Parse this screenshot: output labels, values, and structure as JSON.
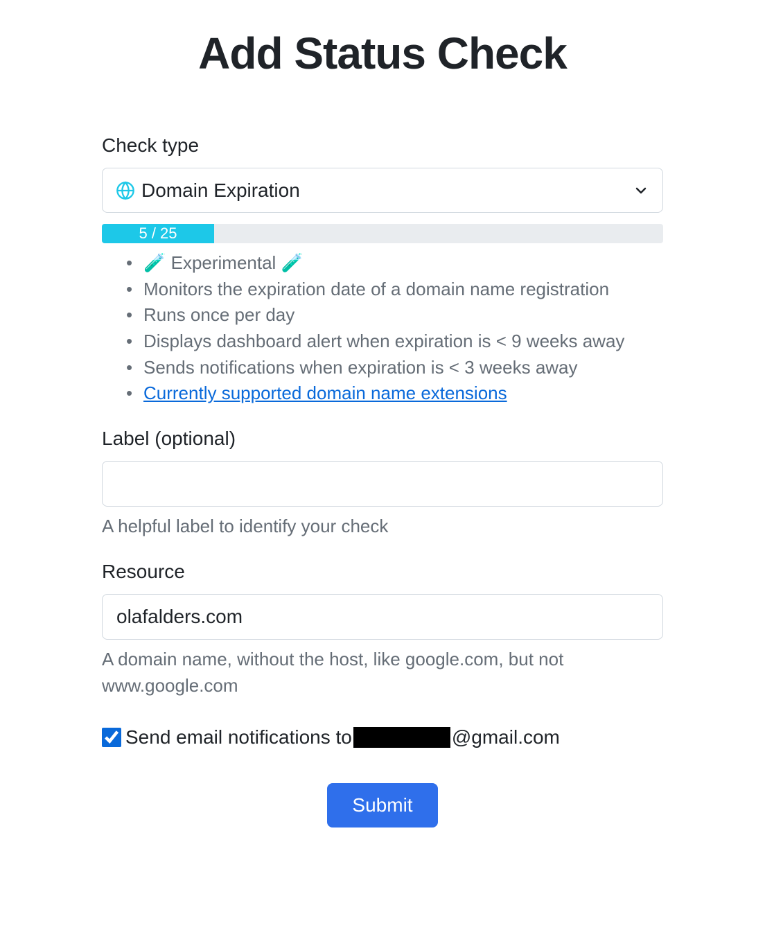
{
  "page": {
    "title": "Add Status Check"
  },
  "check_type": {
    "label": "Check type",
    "selected": "Domain Expiration",
    "icon_name": "globe-icon",
    "usage": {
      "current": 5,
      "max": 25,
      "display": "5 / 25",
      "percent": 20
    },
    "description_items": [
      "🧪 Experimental 🧪",
      "Monitors the expiration date of a domain name registration",
      "Runs once per day",
      "Displays dashboard alert when expiration is < 9 weeks away",
      "Sends notifications when expiration is < 3 weeks away"
    ],
    "description_link_text": "Currently supported domain name extensions"
  },
  "label_field": {
    "label": "Label (optional)",
    "value": "",
    "help": "A helpful label to identify your check"
  },
  "resource_field": {
    "label": "Resource",
    "value": "olafalders.com",
    "help": "A domain name, without the host, like google.com, but not www.google.com"
  },
  "notifications": {
    "checked": true,
    "label_prefix": "Send email notifications to ",
    "email_redacted": true,
    "email_suffix": "@gmail.com"
  },
  "actions": {
    "submit_label": "Submit"
  }
}
